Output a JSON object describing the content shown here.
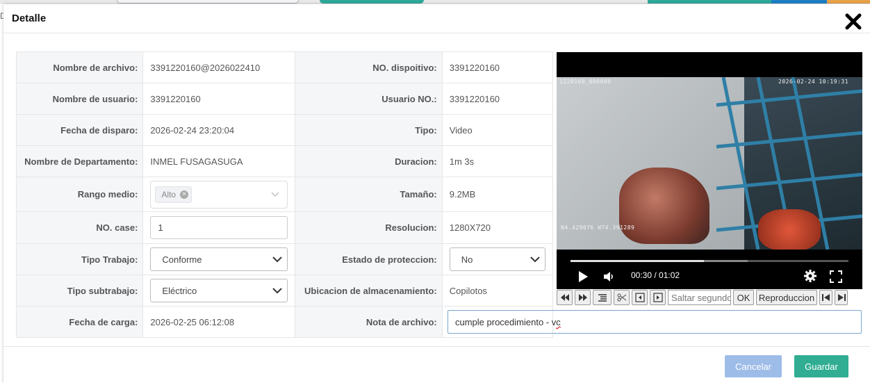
{
  "background": {
    "edge_text": "D"
  },
  "modal": {
    "title": "Detalle",
    "fields": {
      "nombre_archivo": {
        "label": "Nombre de archivo:",
        "value": "3391220160@2026022410"
      },
      "nombre_usuario": {
        "label": "Nombre de usuario:",
        "value": "3391220160"
      },
      "fecha_disparo": {
        "label": "Fecha de disparo:",
        "value": "2026-02-24 23:20:04"
      },
      "departamento": {
        "label": "Nombre de Departamento:",
        "value": "INMEL FUSAGASUGA"
      },
      "rango_medio": {
        "label": "Rango medio:",
        "tag": "Alto"
      },
      "no_case": {
        "label": "NO. case:",
        "value": "1"
      },
      "tipo_trabajo": {
        "label": "Tipo Trabajo:",
        "selected": "Conforme"
      },
      "tipo_subtrabajo": {
        "label": "Tipo subtrabajo:",
        "selected": "Eléctrico"
      },
      "fecha_carga": {
        "label": "Fecha de carga:",
        "value": "2026-02-25 06:12:08"
      },
      "no_dispositivo": {
        "label": "NO. dispoitivo:",
        "value": "3391220160"
      },
      "usuario_no": {
        "label": "Usuario NO.:",
        "value": "3391220160"
      },
      "tipo": {
        "label": "Tipo:",
        "value": "Video"
      },
      "duracion": {
        "label": "Duracion:",
        "value": "1m 3s"
      },
      "tamano": {
        "label": "Tamaño:",
        "value": "9.2MB"
      },
      "resolucion": {
        "label": "Resolucion:",
        "value": "1280X720"
      },
      "estado_proteccion": {
        "label": "Estado de proteccion:",
        "selected": "No"
      },
      "ubicacion": {
        "label": "Ubicacion de almacenamiento:",
        "value": "Copilotos"
      },
      "nota": {
        "label": "Nota de archivo:",
        "value_main": "cumple procedimiento - v",
        "value_squiggle": "c"
      }
    },
    "video": {
      "osd_top_left": "1220160_000000",
      "osd_top_right": "2026-02-24 10:19:31",
      "osd_coords": "N4.429076  W74.391289",
      "current_time": "00:30",
      "duration": "01:02",
      "time_text": "00:30 / 01:02",
      "progress": 0.48
    },
    "toolbar": {
      "skip_placeholder": "Saltar segundos",
      "ok_label": "OK",
      "speed_label": "Reproduccion"
    },
    "buttons": {
      "cancel": "Cancelar",
      "save": "Guardar"
    },
    "colors": {
      "save": "#30ad92",
      "cancel": "#9ebce8"
    }
  }
}
